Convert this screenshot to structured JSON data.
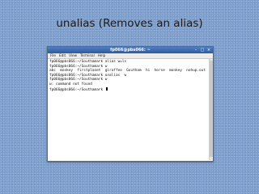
{
  "slide": {
    "title": "unalias (Removes an alias)"
  },
  "window": {
    "title": "fp066@pbs066: ~",
    "controls": {
      "minimize": "–",
      "maximize": "□",
      "close": "×"
    }
  },
  "menu": [
    "File",
    "Edit",
    "View",
    "Terminal",
    "Help"
  ],
  "terminal": {
    "lines": [
      "fp066@pbs066:~/Southamark alias w=ls",
      "fp066@pbs066:~/Southamark w",
      "abc  monkey  firstplanet  giraffee  Goutham  hi  horse  monkey  nohup.out",
      "fp066@pbs066:~/Southamark unalias  w",
      "fp066@pbs066:~/Southamark w",
      "w: command not found",
      "fp066@pbs066:~/Southamark "
    ]
  }
}
